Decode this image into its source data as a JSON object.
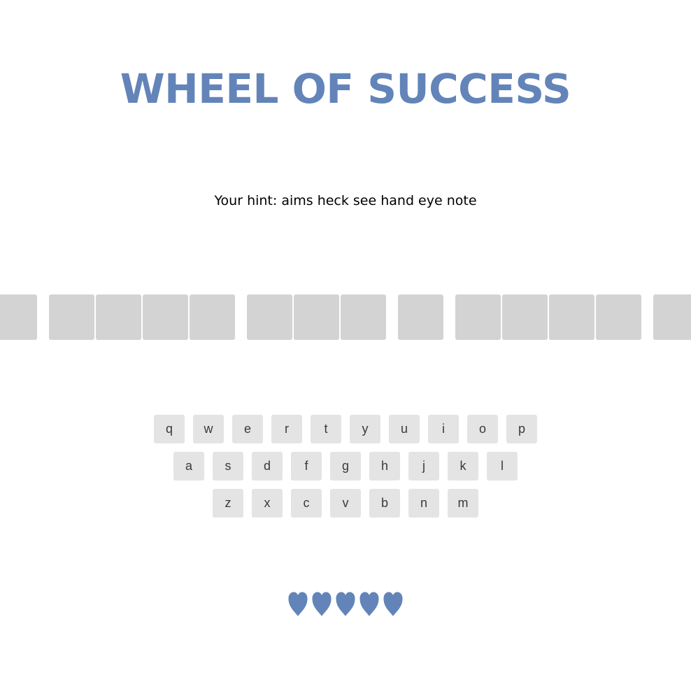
{
  "game": {
    "title": "WHEEL OF SUCCESS",
    "hint": "Your hint: aims heck see hand eye note"
  },
  "board": {
    "tiles": [
      {
        "letter": "",
        "revealed": false
      },
      {
        "letter": "",
        "revealed": false
      },
      {
        "letter": "",
        "revealed": false
      },
      {
        "letter": "",
        "revealed": false
      },
      {
        "letter": "",
        "revealed": false
      },
      {
        "letter": "",
        "revealed": false
      },
      {
        "letter": "",
        "revealed": false
      },
      {
        "letter": "",
        "revealed": false
      },
      {
        "letter": "",
        "revealed": false
      },
      {
        "letter": "",
        "revealed": false
      },
      {
        "letter": "",
        "revealed": false
      },
      {
        "letter": "",
        "revealed": false
      },
      {
        "letter": "",
        "revealed": false
      },
      {
        "letter": "",
        "revealed": false
      },
      {
        "letter": "",
        "revealed": false
      }
    ]
  },
  "keyboard": {
    "rows": [
      [
        "q",
        "w",
        "e",
        "r",
        "t",
        "y",
        "u",
        "i",
        "o",
        "p"
      ],
      [
        "a",
        "s",
        "d",
        "f",
        "g",
        "h",
        "j",
        "k",
        "l"
      ],
      [
        "z",
        "x",
        "c",
        "v",
        "b",
        "n",
        "m"
      ]
    ]
  },
  "lives": {
    "count": 5,
    "icon": "heart-icon"
  },
  "colors": {
    "accent": "#6384b8",
    "tile": "#d3d3d3",
    "key": "#e4e4e4",
    "key_text": "#3a3a3a"
  }
}
